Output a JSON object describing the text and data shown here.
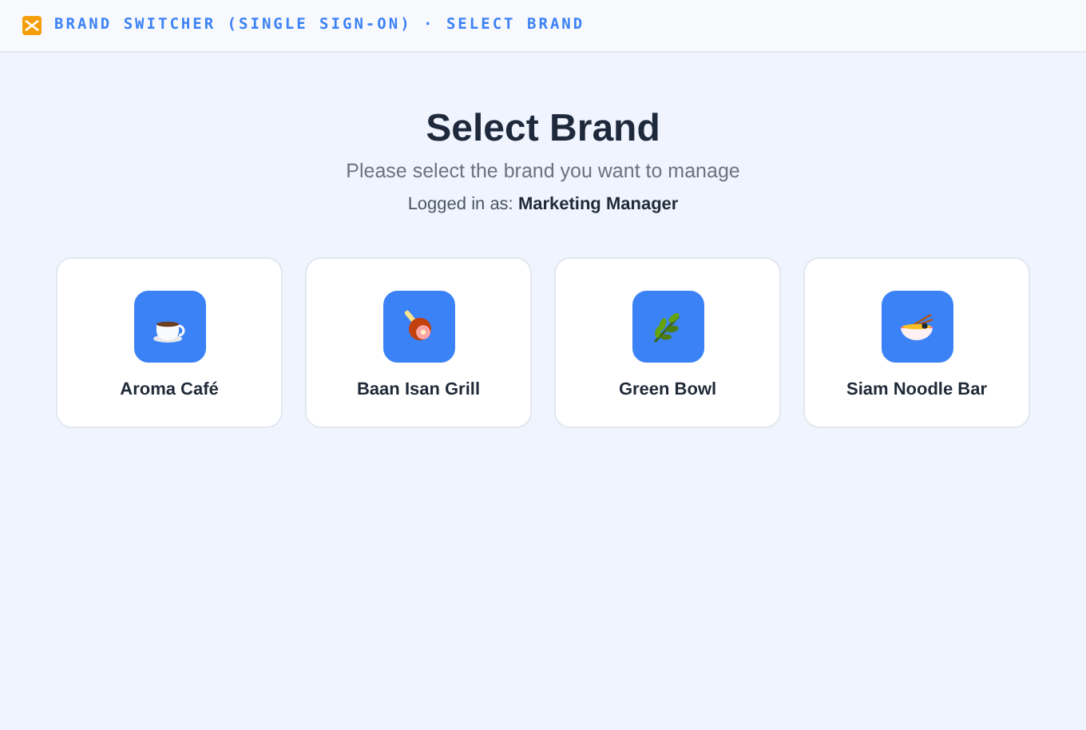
{
  "header": {
    "title": "BRAND SWITCHER (SINGLE SIGN-ON) · SELECT BRAND"
  },
  "heading": "Select Brand",
  "subtitle": "Please select the brand you want to manage",
  "login": {
    "label": "Logged in as:",
    "user": "Marketing Manager"
  },
  "brands": [
    {
      "name": "Aroma Café",
      "kind": "cup"
    },
    {
      "name": "Baan Isan Grill",
      "kind": "meat"
    },
    {
      "name": "Green Bowl",
      "kind": "leaf"
    },
    {
      "name": "Siam Noodle Bar",
      "kind": "noodles"
    }
  ]
}
